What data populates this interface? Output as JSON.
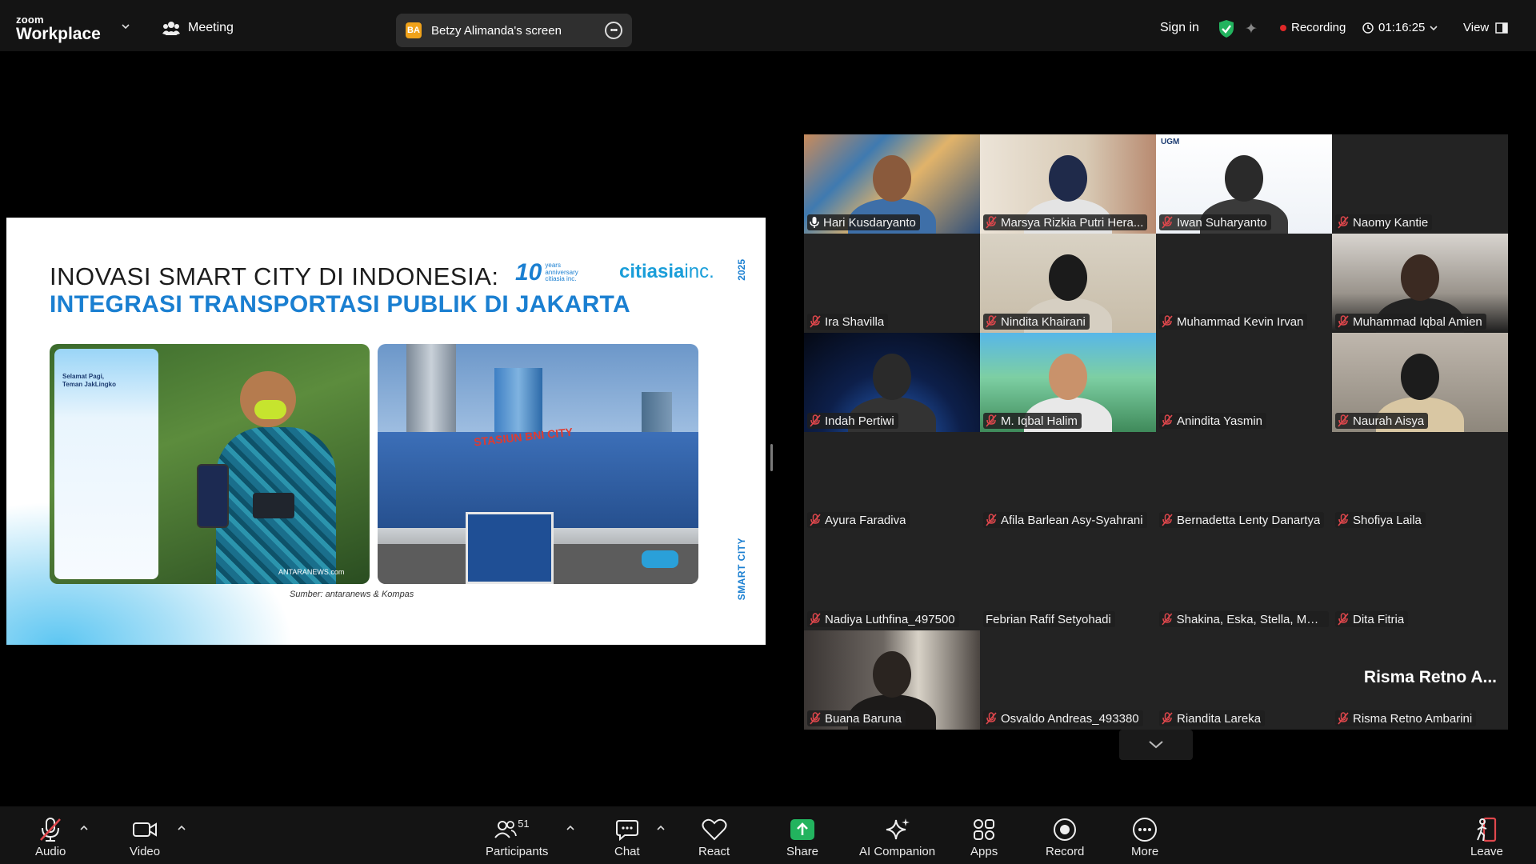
{
  "app": {
    "logo_small": "zoom",
    "logo_big": "Workplace",
    "meeting_label": "Meeting",
    "screen_share": {
      "initials": "BA",
      "label": "Betzy Alimanda's screen"
    },
    "sign_in": "Sign in",
    "recording_label": "Recording",
    "timer": "01:16:25",
    "view_label": "View"
  },
  "slide": {
    "title_line1": "INOVASI SMART CITY DI INDONESIA:",
    "title_line2": "INTEGRASI TRANSPORTASI PUBLIK DI JAKARTA",
    "anniv_number": "10",
    "anniv_text": "years anniversary citiasia inc.",
    "brand_bold": "citiasia",
    "brand_light": "inc.",
    "year": "2025",
    "side_label": "SMART CITY",
    "app_greeting": "Selamat Pagi, Teman JakLingko",
    "photo1_credit": "ANTARANEWS.com",
    "station_sign": "STASIUN BNI CITY",
    "source": "Sumber: antaranews & Kompas"
  },
  "participants": [
    {
      "name": "Hari Kusdaryanto",
      "muted": false,
      "active": true
    },
    {
      "name": "Marsya Rizkia Putri Hera...",
      "muted": true
    },
    {
      "name": "Iwan Suharyanto",
      "muted": true,
      "logo": "UGM"
    },
    {
      "name": "Naomy Kantie",
      "muted": true
    },
    {
      "name": "Ira Shavilla",
      "muted": true
    },
    {
      "name": "Nindita Khairani",
      "muted": true
    },
    {
      "name": "Muhammad Kevin Irvan",
      "muted": true
    },
    {
      "name": "Muhammad Iqbal Amien",
      "muted": true
    },
    {
      "name": "Indah Pertiwi",
      "muted": true
    },
    {
      "name": "M. Iqbal Halim",
      "muted": true
    },
    {
      "name": "Anindita Yasmin",
      "muted": true
    },
    {
      "name": "Naurah Aisya",
      "muted": true
    },
    {
      "name": "Ayura Faradiva",
      "muted": true
    },
    {
      "name": "Afila Barlean Asy-Syahrani",
      "muted": true
    },
    {
      "name": "Bernadetta Lenty Danartya",
      "muted": true
    },
    {
      "name": "Shofiya Laila",
      "muted": true
    },
    {
      "name": "Nadiya Luthfina_497500",
      "muted": true
    },
    {
      "name": "Febrian Rafif Setyohadi",
      "muted": false
    },
    {
      "name": "Shakina, Eska, Stella, Meidy",
      "muted": true
    },
    {
      "name": "Dita Fitria",
      "muted": true
    },
    {
      "name": "Buana Baruna",
      "muted": true
    },
    {
      "name": "Osvaldo Andreas_493380",
      "muted": true
    },
    {
      "name": "Riandita Lareka",
      "muted": true
    },
    {
      "name": "Risma Retno Ambarini",
      "muted": true,
      "display_name": "Risma  Retno  A..."
    }
  ],
  "toolbar": {
    "audio": "Audio",
    "video": "Video",
    "participants": "Participants",
    "participants_count": "51",
    "chat": "Chat",
    "react": "React",
    "share": "Share",
    "ai_companion": "AI Companion",
    "apps": "Apps",
    "record": "Record",
    "more": "More",
    "leave": "Leave"
  },
  "colors": {
    "accent_green": "#29c97a",
    "share_green": "#22b35e",
    "recording_red": "#e02828",
    "mute_red": "#e0474c",
    "slide_blue": "#1a7fd1"
  }
}
